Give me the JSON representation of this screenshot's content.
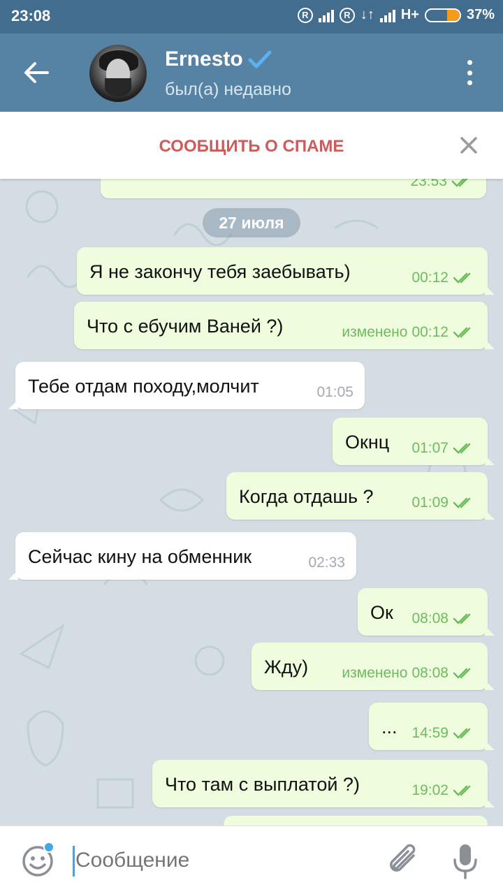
{
  "status_bar": {
    "time": "23:08",
    "network": "H+",
    "battery": "37%",
    "battery_level": 0.37
  },
  "header": {
    "contact_name": "Ernesto",
    "contact_status": "был(а) недавно",
    "icons": {
      "back": "arrow-left-icon",
      "verified": "verified-check-icon",
      "menu": "more-vert-icon"
    }
  },
  "spam_bar": {
    "label": "СООБЩИТЬ О СПАМЕ",
    "close_icon": "close-icon"
  },
  "chat": {
    "partial_message": {
      "time": "23:53"
    },
    "date": "27 июля",
    "messages": [
      {
        "dir": "out",
        "text": "Я не закончу тебя заебывать)",
        "edited": "",
        "time": "00:12"
      },
      {
        "dir": "out",
        "text": "Что с ебучим Ваней ?)",
        "edited": "изменено",
        "time": "00:12"
      },
      {
        "dir": "in",
        "text": "Тебе отдам походу,молчит",
        "edited": "",
        "time": "01:05"
      },
      {
        "dir": "out",
        "text": "Окнц",
        "edited": "",
        "time": "01:07"
      },
      {
        "dir": "out",
        "text": "Когда отдашь ?",
        "edited": "",
        "time": "01:09"
      },
      {
        "dir": "in",
        "text": "Сейчас кину на обменник",
        "edited": "",
        "time": "02:33"
      },
      {
        "dir": "out",
        "text": "Ок",
        "edited": "",
        "time": "08:08"
      },
      {
        "dir": "out",
        "text": "Жду)",
        "edited": "изменено",
        "time": "08:08"
      },
      {
        "dir": "out",
        "text": "...",
        "edited": "",
        "time": "14:59"
      },
      {
        "dir": "out",
        "text": "Что там с выплатой ?)",
        "edited": "",
        "time": "19:02"
      }
    ]
  },
  "input_bar": {
    "placeholder": "Сообщение",
    "icons": {
      "emoji": "emoji-icon",
      "attach": "paperclip-icon",
      "mic": "microphone-icon"
    }
  },
  "colors": {
    "header": "#5682a3",
    "status_bar": "#426d8f",
    "outgoing_bubble": "#effdde",
    "incoming_bubble": "#ffffff",
    "spam_text": "#cf5a5a",
    "check_green": "#6dbb5d",
    "chat_bg": "#d3dde3"
  }
}
